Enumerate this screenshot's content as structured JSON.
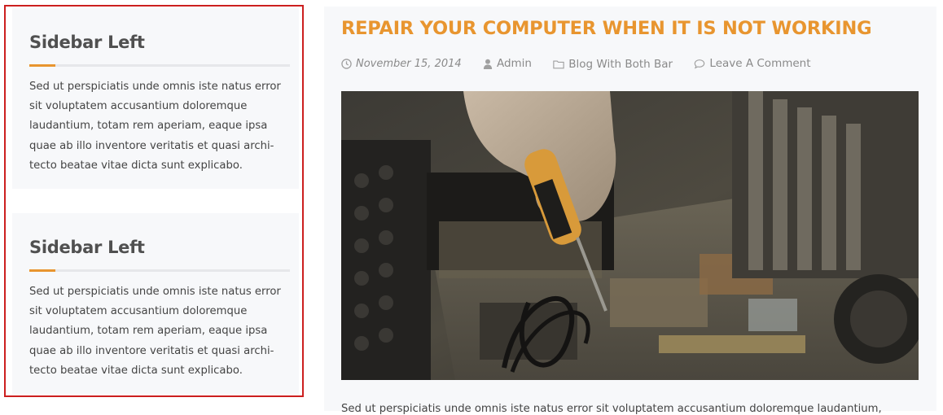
{
  "sidebar": {
    "widgets": [
      {
        "title": "Sidebar Left",
        "text": "Sed ut perspiciatis unde omnis iste natus er­ror sit voluptatem accusantium doloremque laudantium, totam rem aperiam, eaque ipsa quae ab illo inventore veritatis et quasi archi­tecto beatae vitae dicta sunt explicabo."
      },
      {
        "title": "Sidebar Left",
        "text": "Sed ut perspiciatis unde omnis iste natus er­ror sit voluptatem accusantium doloremque laudantium, totam rem aperiam, eaque ipsa quae ab illo inventore veritatis et quasi archi­tecto beatae vitae dicta sunt explicabo."
      }
    ]
  },
  "post": {
    "title": "REPAIR YOUR COMPUTER WHEN IT IS NOT WORKING",
    "date": "November 15, 2014",
    "author": "Admin",
    "category": "Blog With Both Bar",
    "comment_link": "Leave A Comment",
    "excerpt": "Sed ut perspiciatis unde omnis iste natus error sit voluptatem accusantium doloremque laudantium,"
  },
  "colors": {
    "accent": "#e8952f",
    "highlight_border": "#cc1f1f",
    "panel_bg": "#f7f8fa",
    "meta_text": "#8a8a8a"
  },
  "icons": {
    "date": "clock-icon",
    "author": "user-icon",
    "category": "folder-icon",
    "comment": "comment-icon"
  }
}
